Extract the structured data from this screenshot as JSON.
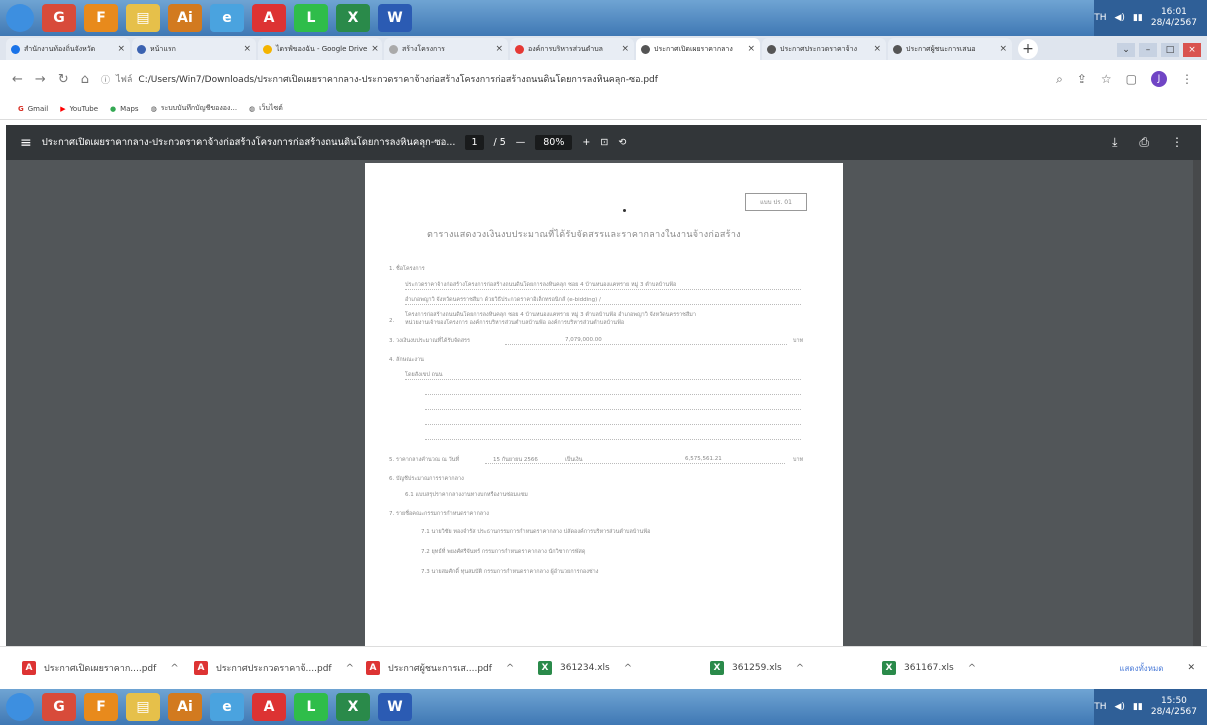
{
  "taskbar_top": {
    "apps": [
      {
        "icon": "start-orb-icon",
        "glyph": "",
        "color": "#3d8fe0"
      },
      {
        "icon": "chrome-icon",
        "glyph": "G",
        "color": "#d84b3a"
      },
      {
        "icon": "firefox-icon",
        "glyph": "F",
        "color": "#e88a1c"
      },
      {
        "icon": "folder-icon",
        "glyph": "▤",
        "color": "#e6c04a"
      },
      {
        "icon": "illustrator-icon",
        "glyph": "Ai",
        "color": "#d27a1f"
      },
      {
        "icon": "ie-icon",
        "glyph": "e",
        "color": "#4aa3df"
      },
      {
        "icon": "acrobat-icon",
        "glyph": "A",
        "color": "#d33"
      },
      {
        "icon": "line-icon",
        "glyph": "L",
        "color": "#2fbd4a"
      },
      {
        "icon": "excel-icon",
        "glyph": "X",
        "color": "#2a8a4a"
      },
      {
        "icon": "word-icon",
        "glyph": "W",
        "color": "#2b5bb3"
      }
    ],
    "tray_lang": "TH",
    "time": "16:01",
    "date": "28/4/2567"
  },
  "tabs": [
    {
      "label": "สำนักงานท้องถิ่นจังหวัด",
      "color": "#1a73e8",
      "active": false
    },
    {
      "label": "หน้าแรก",
      "color": "#3b62b0",
      "active": false
    },
    {
      "label": "ไดรฟ์ของฉัน - Google Drive",
      "color": "#f4b400",
      "active": false
    },
    {
      "label": "สร้างโครงการ",
      "color": "#aaa",
      "active": false
    },
    {
      "label": "องค์การบริหารส่วนตำบล",
      "color": "#e53935",
      "active": false
    },
    {
      "label": "ประกาศเปิดเผยราคากลาง",
      "color": "#555",
      "active": true
    },
    {
      "label": "ประกาศประกวดราคาจ้าง",
      "color": "#555",
      "active": false
    },
    {
      "label": "ประกาศผู้ชนะการเสนอ",
      "color": "#555",
      "active": false
    }
  ],
  "address": {
    "info_label": "ไฟล์",
    "url": "C:/Users/Win7/Downloads/ประกาศเปิดเผยราคากลาง-ประกวดราคาจ้างก่อสร้างโครงการก่อสร้างถนนดินโดยการลงหินคลุก-ซอ.pdf",
    "avatar_letter": "J"
  },
  "bookmarks": [
    {
      "label": "Gmail",
      "icon": "gmail-icon",
      "color": "#d93025"
    },
    {
      "label": "YouTube",
      "icon": "youtube-icon",
      "color": "#ff0000"
    },
    {
      "label": "Maps",
      "icon": "maps-icon",
      "color": "#34a853"
    },
    {
      "label": "ระบบบันทึกบัญชีขององ...",
      "icon": "globe-icon",
      "color": "#555"
    },
    {
      "label": "เว็บไซต์",
      "icon": "globe-icon",
      "color": "#555"
    }
  ],
  "pdf": {
    "title": "ประกาศเปิดเผยราคากลาง-ประกวดราคาจ้างก่อสร้างโครงการก่อสร้างถนนดินโดยการลงหินคลุก-ซอ...",
    "page": "1",
    "total": "/ 5",
    "zoom": "80%"
  },
  "doc": {
    "form_code": "แบบ ปร. 01",
    "heading": "ตารางแสดงวงเงินงบประมาณที่ได้รับจัดสรรและราคากลางในงานจ้างก่อสร้าง",
    "s1": "1.  ชื่อโครงการ",
    "s1_l1": "ประกวดราคาจ้างก่อสร้างโครงการก่อสร้างถนนดินโดยการลงหินคลุก ซอย 4 บ้านหนองแคทราย หมู่ 3 ตำบลบ้านฟ้อ",
    "s1_l2": "อำเภอพญาวิ จังหวัดนครราชสีมา ด้วยวิธีประกวดราคาอิเล็กทรอนิกส์ (e-bidding) /",
    "s2": "2.",
    "s2_l1": "โครงการก่อสร้างถนนดินโดยการลงหินคลุก ซอย 4 บ้านหนองแคทราย หมู่ 3 ตำบลบ้านฟ้อ อำเภอพญาวิ จังหวัดนครราชสีมา",
    "s2_l2": "หน่วยงานเจ้าของโครงการ    องค์การบริหารส่วนตำบลบ้านฟ้อ  องค์การบริหารส่วนตำบลบ้านฟ้อ",
    "s3_label": "3.  วงเงินงบประมาณที่ได้รับจัดสรร",
    "s3_value": "7,079,000.00",
    "s3_unit": "บาท",
    "s4": "4.  ลักษณะงาน",
    "s4_l1": "โดยสังเขป  ถนน",
    "s5_label": "5.  ราคากลางคำนวณ ณ วันที่",
    "s5_date": "15 กันยายน 2566",
    "s5_mid": "เป็นเงิน",
    "s5_value": "6,575,561.21",
    "s5_unit": "บาท",
    "s6": "6.  บัญชีประมาณการราคากลาง",
    "s6_1": "6.1  แบบสรุปราคากลางงานทางบกหรืองานซ่อมแซม",
    "s7": "7.  รายชื่อคณะกรรมการกำหนดราคากลาง",
    "s7_1": "7.1  นายวิชัย  ทองจำรัส  ประธานกรรมการกำหนดราคากลาง  ปลัดองค์การบริหารส่วนตำบลบ้านฟ้อ",
    "s7_2": "7.2  ยุทธ์ที่  พยงศ์ศรีจันทร์  กรรมการกำหนดราคากลาง  นักวิชาการพัสดุ",
    "s7_3": "7.3  นายสมศักดิ์  ทุนสมบัติ  กรรมการกำหนดราคากลาง  ผู้อำนวยการกองช่าง"
  },
  "downloads": [
    {
      "name": "ประกาศเปิดเผยราคาก....pdf",
      "type": "pdf"
    },
    {
      "name": "ประกาศประกวดราคาจ้....pdf",
      "type": "pdf"
    },
    {
      "name": "ประกาศผู้ชนะการเส....pdf",
      "type": "pdf"
    },
    {
      "name": "361234.xls",
      "type": "xls"
    },
    {
      "name": "361259.xls",
      "type": "xls"
    },
    {
      "name": "361167.xls",
      "type": "xls"
    }
  ],
  "downloads_show_all": "แสดงทั้งหมด",
  "taskbar_bottom": {
    "tray_lang": "TH",
    "time": "15:50",
    "date": "28/4/2567"
  }
}
